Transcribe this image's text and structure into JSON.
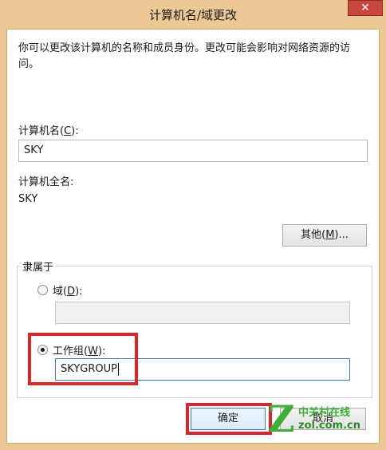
{
  "window": {
    "title": "计算机名/域更改",
    "close_glyph": "✕"
  },
  "description": "你可以更改该计算机的名称和成员身份。更改可能会影响对网络资源的访问。",
  "computer_name": {
    "label_prefix": "计算机名(",
    "accel": "C",
    "label_suffix": "):",
    "value": "SKY"
  },
  "full_name": {
    "label": "计算机全名:",
    "value": "SKY"
  },
  "more_button": {
    "prefix": "其他(",
    "accel": "M",
    "suffix": ")..."
  },
  "member_of": {
    "title": "隶属于",
    "domain": {
      "label_prefix": "域(",
      "accel": "D",
      "label_suffix": "):",
      "value": "",
      "selected": false
    },
    "workgroup": {
      "label_prefix": "工作组(",
      "accel": "W",
      "label_suffix": "):",
      "value": "SKYGROUP",
      "selected": true
    }
  },
  "buttons": {
    "ok": "确定",
    "cancel": "取消"
  },
  "watermark": {
    "logo_letter": "Z",
    "line1": "中关村在线",
    "line2": "zol.com.cn"
  },
  "colors": {
    "highlight": "#d8262c",
    "frame": "#ecc994",
    "close": "#c7463d",
    "watermark": "#3fae3a"
  }
}
